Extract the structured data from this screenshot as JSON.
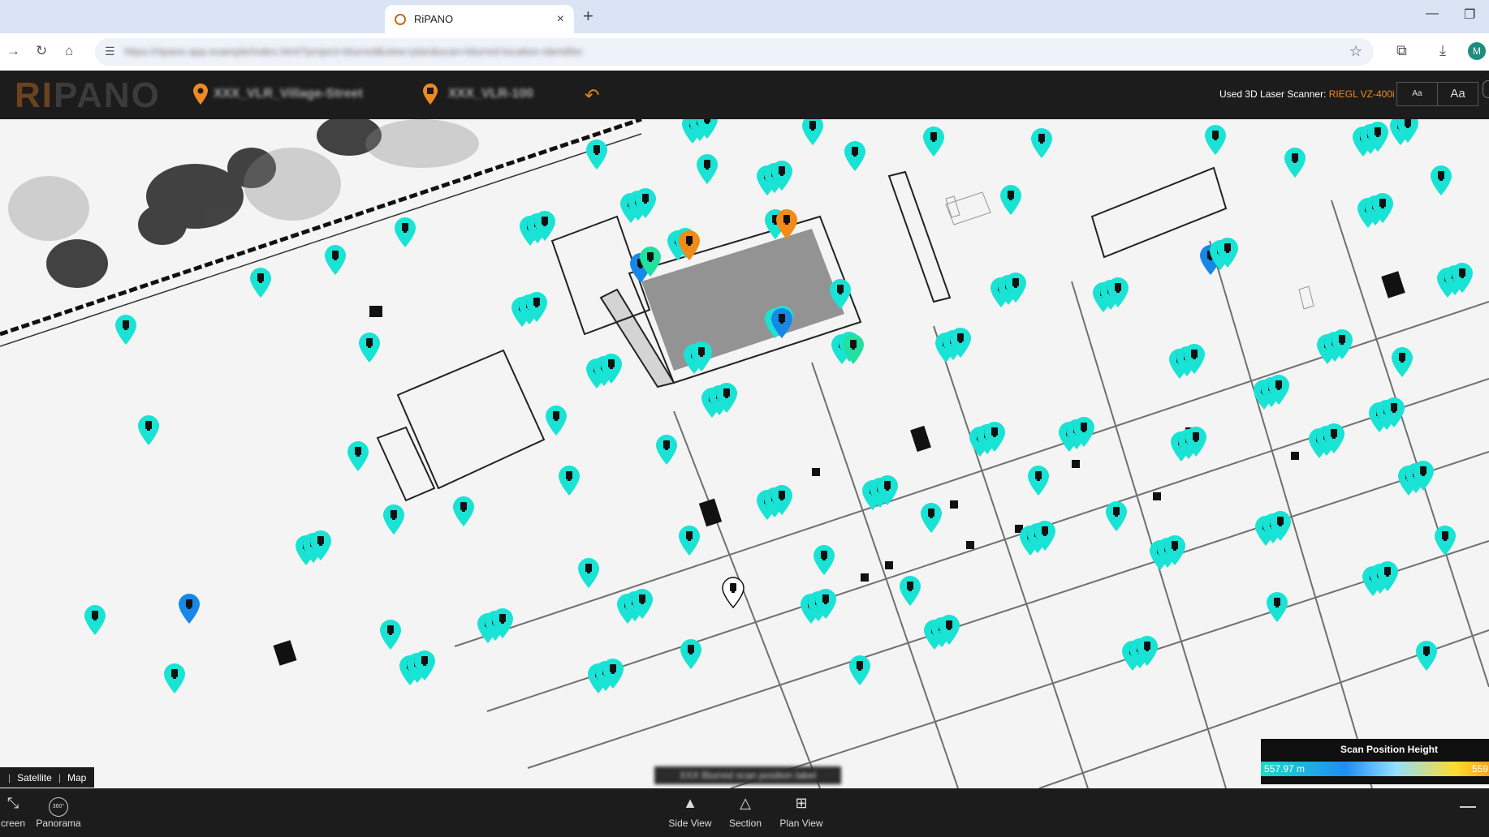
{
  "browser": {
    "tab_title": "RiPANO",
    "tab_close": "×",
    "new_tab": "+",
    "url": "https://ripano-app.example/index.html?project=blurred&view=plan&scan=blurred-location-identifier",
    "avatar_letter": "M"
  },
  "header": {
    "logo_ri": "RI",
    "logo_pano": "PANO",
    "location_primary": "XXX_VLR_Village-Street",
    "location_secondary": "XXX_VLR-100",
    "location_pin_color": "#ef8a23",
    "scanner_label": "Used 3D Laser Scanner:",
    "scanner_value": "RIEGL VZ-400i",
    "font_small": "Aa",
    "font_large": "Aa",
    "edge_text": "A"
  },
  "map": {
    "type_buttons": [
      "Satellite",
      "Map"
    ],
    "type_separator": "|",
    "center_label": "XXX Blurred scan position label",
    "marker_colors": {
      "cyan": "#19e3d4",
      "teal_green": "#22e0a0",
      "blue": "#1689e8",
      "orange": "#f28a18",
      "outline": "#ffffff"
    }
  },
  "legend": {
    "title": "Scan Position Height",
    "min": "557.97 m",
    "max": "559"
  },
  "bottom_bar": {
    "fullscreen": "creen",
    "panorama": "Panorama",
    "panorama_badge": "360°",
    "side_view": "Side View",
    "section": "Section",
    "plan_view": "Plan View"
  }
}
